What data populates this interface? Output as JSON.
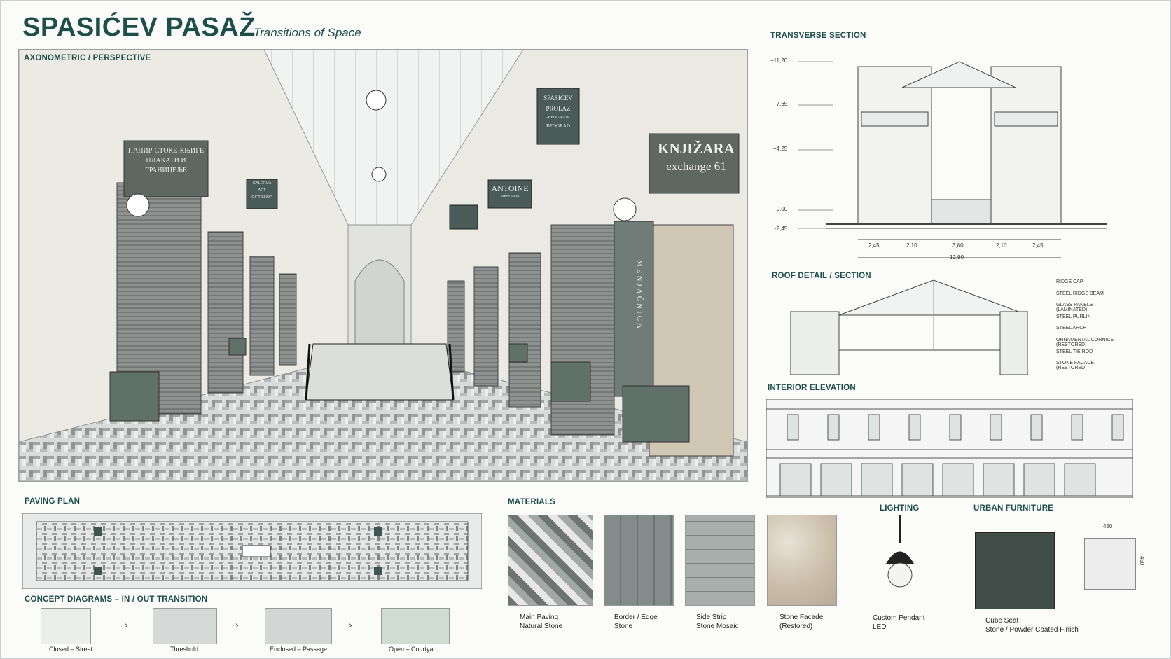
{
  "header": {
    "title": "SPASIĆEV PASAŽ",
    "subtitle": "Transitions of Space"
  },
  "perspective": {
    "label": "AXONOMETRIC / PERSPECTIVE",
    "signs": {
      "left_cyrillic_1": "ПАПИР-СТОКЕ-КЊИГЕ",
      "left_cyrillic_2": "ПЛАКАТИ И ГРАНИЦЕЉЕ",
      "galerija_1": "GALERIJA",
      "galerija_2": "ART",
      "galerija_3": "GIFT SHOP",
      "spasicev_1": "SPASIĆEV",
      "spasicev_2": "PROLAZ",
      "spasicev_3": "-BEOGRAD-",
      "spasicev_4": "BEOGRAD",
      "antoine_1": "ANTOINE",
      "antoine_2": "Since 1936",
      "knjizara_1": "KNJIŽARA",
      "knjizara_2": "exchange 61",
      "menjacnica": "MENJAČNICA"
    }
  },
  "transverse": {
    "label": "TRANSVERSE SECTION",
    "levels": [
      "+11,20",
      "+7,65",
      "+4,25",
      "+0,00",
      "-2,45"
    ],
    "dims": [
      "2,45",
      "2,10",
      "3,80",
      "2,10",
      "2,45"
    ],
    "total": "12,90"
  },
  "roof": {
    "label": "ROOF DETAIL / SECTION",
    "callouts": [
      "RIDGE CAP",
      "STEEL RIDGE BEAM",
      "GLASS PANELS (LAMINATED)",
      "STEEL PURLIN",
      "STEEL ARCH",
      "ORNAMENTAL CORNICE (RESTORED)",
      "STEEL TIE ROD",
      "STONE FACADE (RESTORED)"
    ]
  },
  "elevation": {
    "label": "INTERIOR ELEVATION"
  },
  "paving": {
    "label": "PAVING PLAN"
  },
  "concept": {
    "label": "CONCEPT DIAGRAMS – IN / OUT TRANSITION",
    "steps": [
      "Closed – Street",
      "Threshold",
      "Enclosed – Passage",
      "Open – Courtyard"
    ]
  },
  "materials": {
    "label": "MATERIALS",
    "items": [
      {
        "line1": "Main Paving",
        "line2": "Natural Stone"
      },
      {
        "line1": "Border / Edge",
        "line2": "Stone"
      },
      {
        "line1": "Side Strip",
        "line2": "Stone Mosaic"
      },
      {
        "line1": "Stone Facade",
        "line2": "(Restored)"
      }
    ]
  },
  "lighting": {
    "label": "LIGHTING",
    "line1": "Custom Pendant",
    "line2": "LED"
  },
  "furniture": {
    "label": "URBAN FURNITURE",
    "line1": "Cube Seat",
    "line2": "Stone / Powder Coated Finish",
    "dim_w": "450",
    "dim_h": "450"
  },
  "colors": {
    "accent": "#1d4f4a",
    "stone_green": "#5f7168",
    "paper": "#fbfbfa"
  }
}
